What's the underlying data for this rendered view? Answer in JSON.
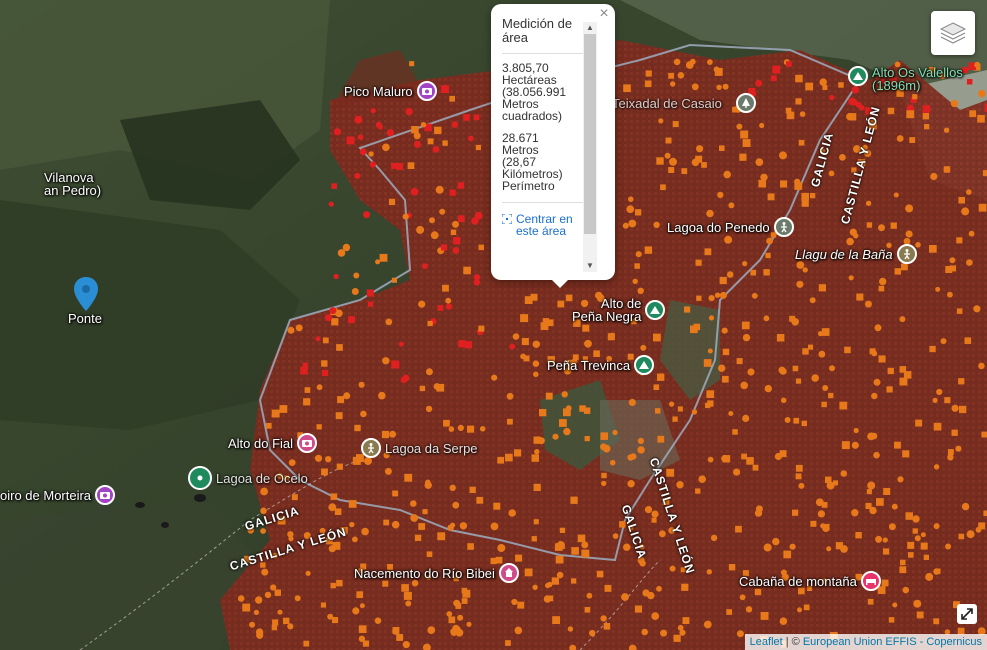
{
  "popup": {
    "title": "Medición de área",
    "area_value": "3.805,70",
    "area_unit": "Hectáreas",
    "area_secondary": "(38.056.991 Metros cuadrados)",
    "perimeter_value": "28.671",
    "perimeter_unit": "Metros",
    "perimeter_secondary": "(28,67 Kilómetros)",
    "perimeter_label": "Perímetro",
    "center_link": "Centrar en este área",
    "close_symbol": "×"
  },
  "places": {
    "pico_maluro": "Pico Maluro",
    "vilanova": "Vilanova",
    "vilanova_sub": "an Pedro)",
    "ponte": "Ponte",
    "teixadal": "Teixadal de Casaio",
    "alto_os_valellos": "Alto Os Valellos",
    "alto_os_valellos_sub": "(1896m)",
    "lagoa_penedo": "Lagoa do Penedo",
    "llagu_bana": "Llagu de la Baña",
    "alto_pena_negra": "Alto de",
    "alto_pena_negra_sub": "Peña Negra",
    "pena_trevinca": "Peña Trevinca",
    "alto_fial": "Alto do Fial",
    "lagoa_serpe": "Lagoa da Serpe",
    "lagoa_ocelo": "Lagoa de Ocelo",
    "miradoiro_morteira": "oiro de Morteira",
    "nacemento_bibei": "Nacemento do Río Bibei",
    "cabana_montana": "Cabaña de montaña"
  },
  "roads": {
    "galicia_1": "GALICIA",
    "castilla_1": "CASTILLA Y LEÓN",
    "galicia_2": "GALICIA",
    "castilla_2": "CASTILLA Y LEÓN",
    "galicia_3": "GALICIA",
    "castilla_3": "CASTILLA Y LEÓN"
  },
  "attribution": {
    "leaflet": "Leaflet",
    "separator": " | © ",
    "source": "European Union EFFIS - Copernicus"
  },
  "controls": {
    "layers_icon": "layers-icon",
    "expand_icon": "expand-icon"
  },
  "colors": {
    "burned_area": "#8b2a20",
    "hotspot_red": "#e02020",
    "hotspot_orange": "#e8791a",
    "polygon_outline": "#9aa6b8",
    "link": "#1a6fd1"
  }
}
